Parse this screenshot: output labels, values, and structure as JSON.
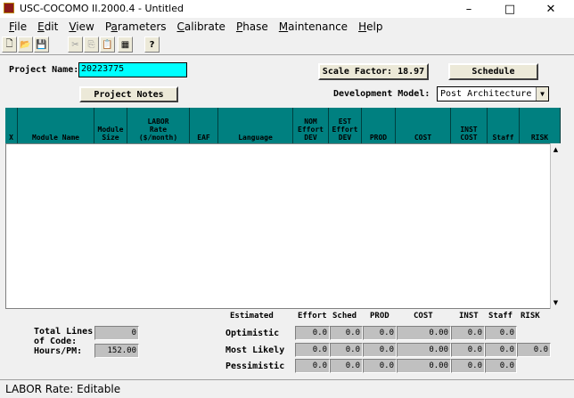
{
  "window": {
    "title": "USC-COCOMO II.2000.4 - Untitled",
    "minimize": "–",
    "maximize": "□",
    "close": "✕"
  },
  "menu": [
    {
      "pre": "",
      "u": "F",
      "post": "ile"
    },
    {
      "pre": "",
      "u": "E",
      "post": "dit"
    },
    {
      "pre": "",
      "u": "V",
      "post": "iew"
    },
    {
      "pre": "P",
      "u": "a",
      "post": "rameters"
    },
    {
      "pre": "",
      "u": "C",
      "post": "alibrate"
    },
    {
      "pre": "",
      "u": "P",
      "post": "hase"
    },
    {
      "pre": "",
      "u": "M",
      "post": "aintenance"
    },
    {
      "pre": "",
      "u": "H",
      "post": "elp"
    }
  ],
  "toolbar": {
    "new": "🗋",
    "open": "📂",
    "save": "💾",
    "cut": "✂",
    "copy": "⎘",
    "paste": "📋",
    "grid": "▦",
    "help": "?"
  },
  "form": {
    "project_name_label": "Project Name:",
    "project_name_value": "20223775",
    "scale_factor_label": "Scale Factor: 18.97",
    "schedule_label": "Schedule",
    "project_notes_label": "Project Notes",
    "dev_model_label": "Development Model:",
    "dev_model_value": "Post Architecture"
  },
  "columns": [
    {
      "key": "x",
      "label": "X",
      "w": 14
    },
    {
      "key": "name",
      "label": "Module Name",
      "w": 86
    },
    {
      "key": "size",
      "label": "Module\nSize",
      "w": 37
    },
    {
      "key": "labor",
      "label": "LABOR\nRate\n($/month)",
      "w": 70
    },
    {
      "key": "eaf",
      "label": "EAF",
      "w": 32
    },
    {
      "key": "lang",
      "label": "Language",
      "w": 84
    },
    {
      "key": "nom",
      "label": "NOM\nEffort\nDEV",
      "w": 40
    },
    {
      "key": "est",
      "label": "EST\nEffort\nDEV",
      "w": 37
    },
    {
      "key": "prod",
      "label": "PROD",
      "w": 38
    },
    {
      "key": "cost",
      "label": "COST",
      "w": 62
    },
    {
      "key": "inst",
      "label": "INST\nCOST",
      "w": 41
    },
    {
      "key": "staff",
      "label": "Staff",
      "w": 36
    },
    {
      "key": "risk",
      "label": "RISK",
      "w": 46
    }
  ],
  "summary": {
    "headers": {
      "estimated": "Estimated",
      "effort": "Effort",
      "sched": "Sched",
      "prod": "PROD",
      "cost": "COST",
      "inst": "INST",
      "staff": "Staff",
      "risk": "RISK"
    },
    "total_lines_label": "Total Lines\nof Code:",
    "total_lines_value": "0",
    "hours_label": "Hours/PM:",
    "hours_value": "152.00",
    "rows": [
      {
        "label": "Optimistic",
        "effort": "0.0",
        "sched": "0.0",
        "prod": "0.0",
        "cost": "0.00",
        "inst": "0.0",
        "staff": "0.0"
      },
      {
        "label": "Most Likely",
        "effort": "0.0",
        "sched": "0.0",
        "prod": "0.0",
        "cost": "0.00",
        "inst": "0.0",
        "staff": "0.0",
        "risk": "0.0"
      },
      {
        "label": "Pessimistic",
        "effort": "0.0",
        "sched": "0.0",
        "prod": "0.0",
        "cost": "0.00",
        "inst": "0.0",
        "staff": "0.0"
      }
    ]
  },
  "status": "LABOR Rate: Editable"
}
